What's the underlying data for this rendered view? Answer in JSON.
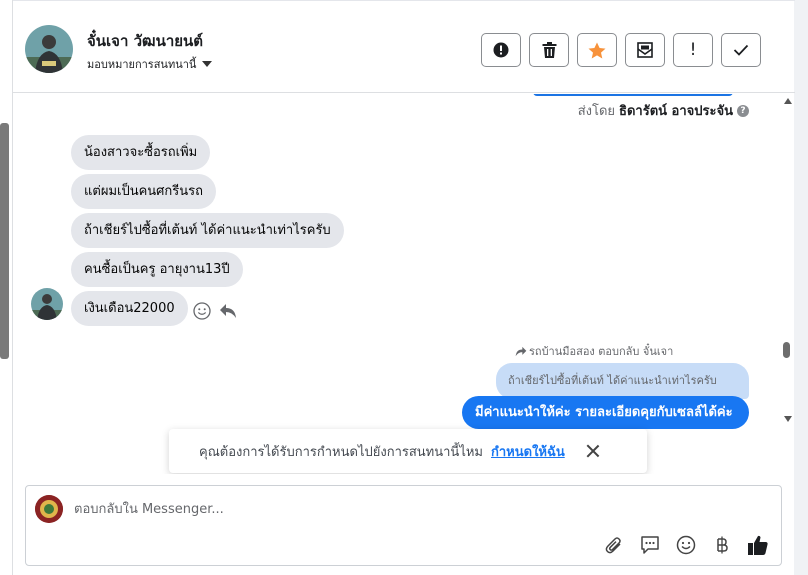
{
  "header": {
    "contact_name": "จั๋นเจา วัฒนายนต์",
    "assign_label": "มอบหมายการสนทนานี้",
    "actions": [
      {
        "name": "alert-circle-icon"
      },
      {
        "name": "trash-icon"
      },
      {
        "name": "star-icon",
        "color": "#f7923b"
      },
      {
        "name": "mark-unread-icon"
      },
      {
        "name": "exclamation-icon",
        "glyph": "!"
      },
      {
        "name": "checkmark-icon"
      }
    ]
  },
  "thread": {
    "sent_by_prefix": "ส่งโดย",
    "sent_by_name": "ธิดารัตน์ อาจประจัน",
    "incoming": [
      "น้องสาวจะซื้อรถเพิ่ม",
      "แต่ผมเป็นคนศกรีนรถ",
      "ถ้าเชียร์ไปซื้อที่เต้นท์  ได้ค่าแนะนำเท่าไรครับ",
      "คนซื้อเป็นครู  อายุงาน13ปี",
      "เงินเดือน22000"
    ],
    "reply_label": "รถบ้านมือสอง ตอบกลับ จั๋นเจา",
    "quoted_text": "ถ้าเชียร์ไปซื้อที่เต้นท์ ได้ค่าแนะนำเท่าไรครับ",
    "outgoing": "มีค่าแนะนำให้ค่ะ รายละเอียดคุยกับเซลล์ได้ค่ะ"
  },
  "toast": {
    "text": "คุณต้องการได้รับการกำหนดไปยังการสนทนานี้ไหม",
    "link": "กำหนดให้ฉัน"
  },
  "composer": {
    "placeholder": "ตอบกลับใน Messenger...",
    "value": ""
  },
  "colors": {
    "accent": "#1877f2",
    "quoted_bg": "#c7dcf7",
    "incoming_bg": "#e4e6eb"
  }
}
